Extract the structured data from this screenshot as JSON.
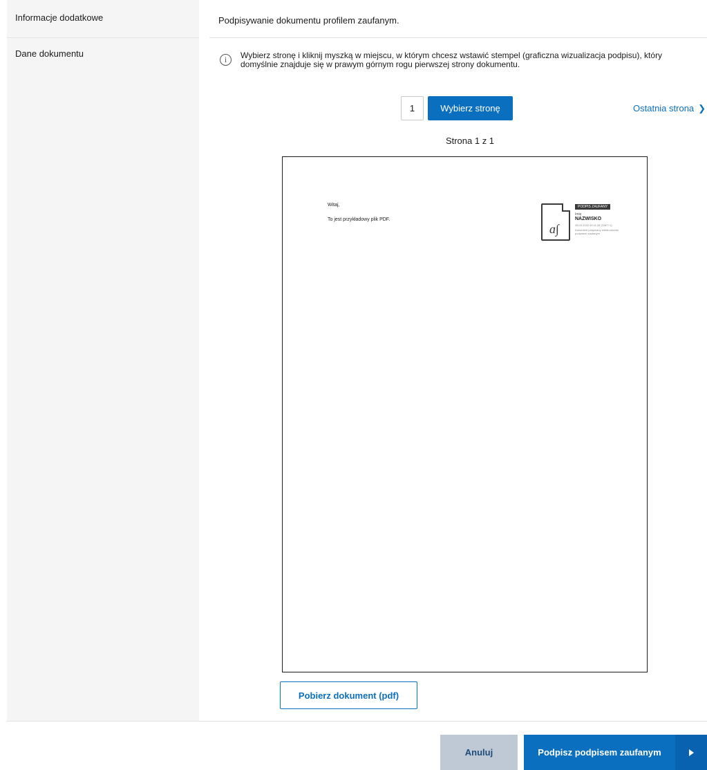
{
  "sidebar": {
    "items": [
      {
        "label": "Informacje dodatkowe"
      },
      {
        "label": "Dane dokumentu"
      }
    ]
  },
  "main": {
    "title": "Podpisywanie dokumentu profilem zaufanym.",
    "info": "Wybierz stronę i kliknij myszką w miejscu, w którym chcesz wstawić stempel (graficzna wizualizacja podpisu), który domyślnie znajduje się w prawym górnym rogu pierwszej strony dokumentu.",
    "info_icon": "info-circle-icon",
    "pager": {
      "page_value": "1",
      "select_button": "Wybierz stronę",
      "last_page_link": "Ostatnia strona",
      "last_page_icon": "chevron-right-icon",
      "page_counter": "Strona 1 z 1"
    },
    "preview": {
      "lines": [
        "Witaj,",
        "To jest przykładowy plik PDF."
      ],
      "stamp": {
        "badge": "PODPIS ZAUFANY",
        "first_name": "Imię",
        "last_name": "NAZWISKO",
        "date": "28.03.2020 00:11:28 (GMT+1)",
        "description": "Dokument podpisany elektronicznie podpisem zaufanym"
      }
    },
    "download_button": "Pobierz dokument (pdf)"
  },
  "footer": {
    "cancel_button": "Anuluj",
    "sign_button": "Podpisz podpisem zaufanym",
    "sign_icon": "arrow-right-icon"
  },
  "colors": {
    "primary": "#0b6fbf",
    "cancel_bg": "#bfc9d6",
    "sidebar_bg": "#f5f5f5"
  }
}
